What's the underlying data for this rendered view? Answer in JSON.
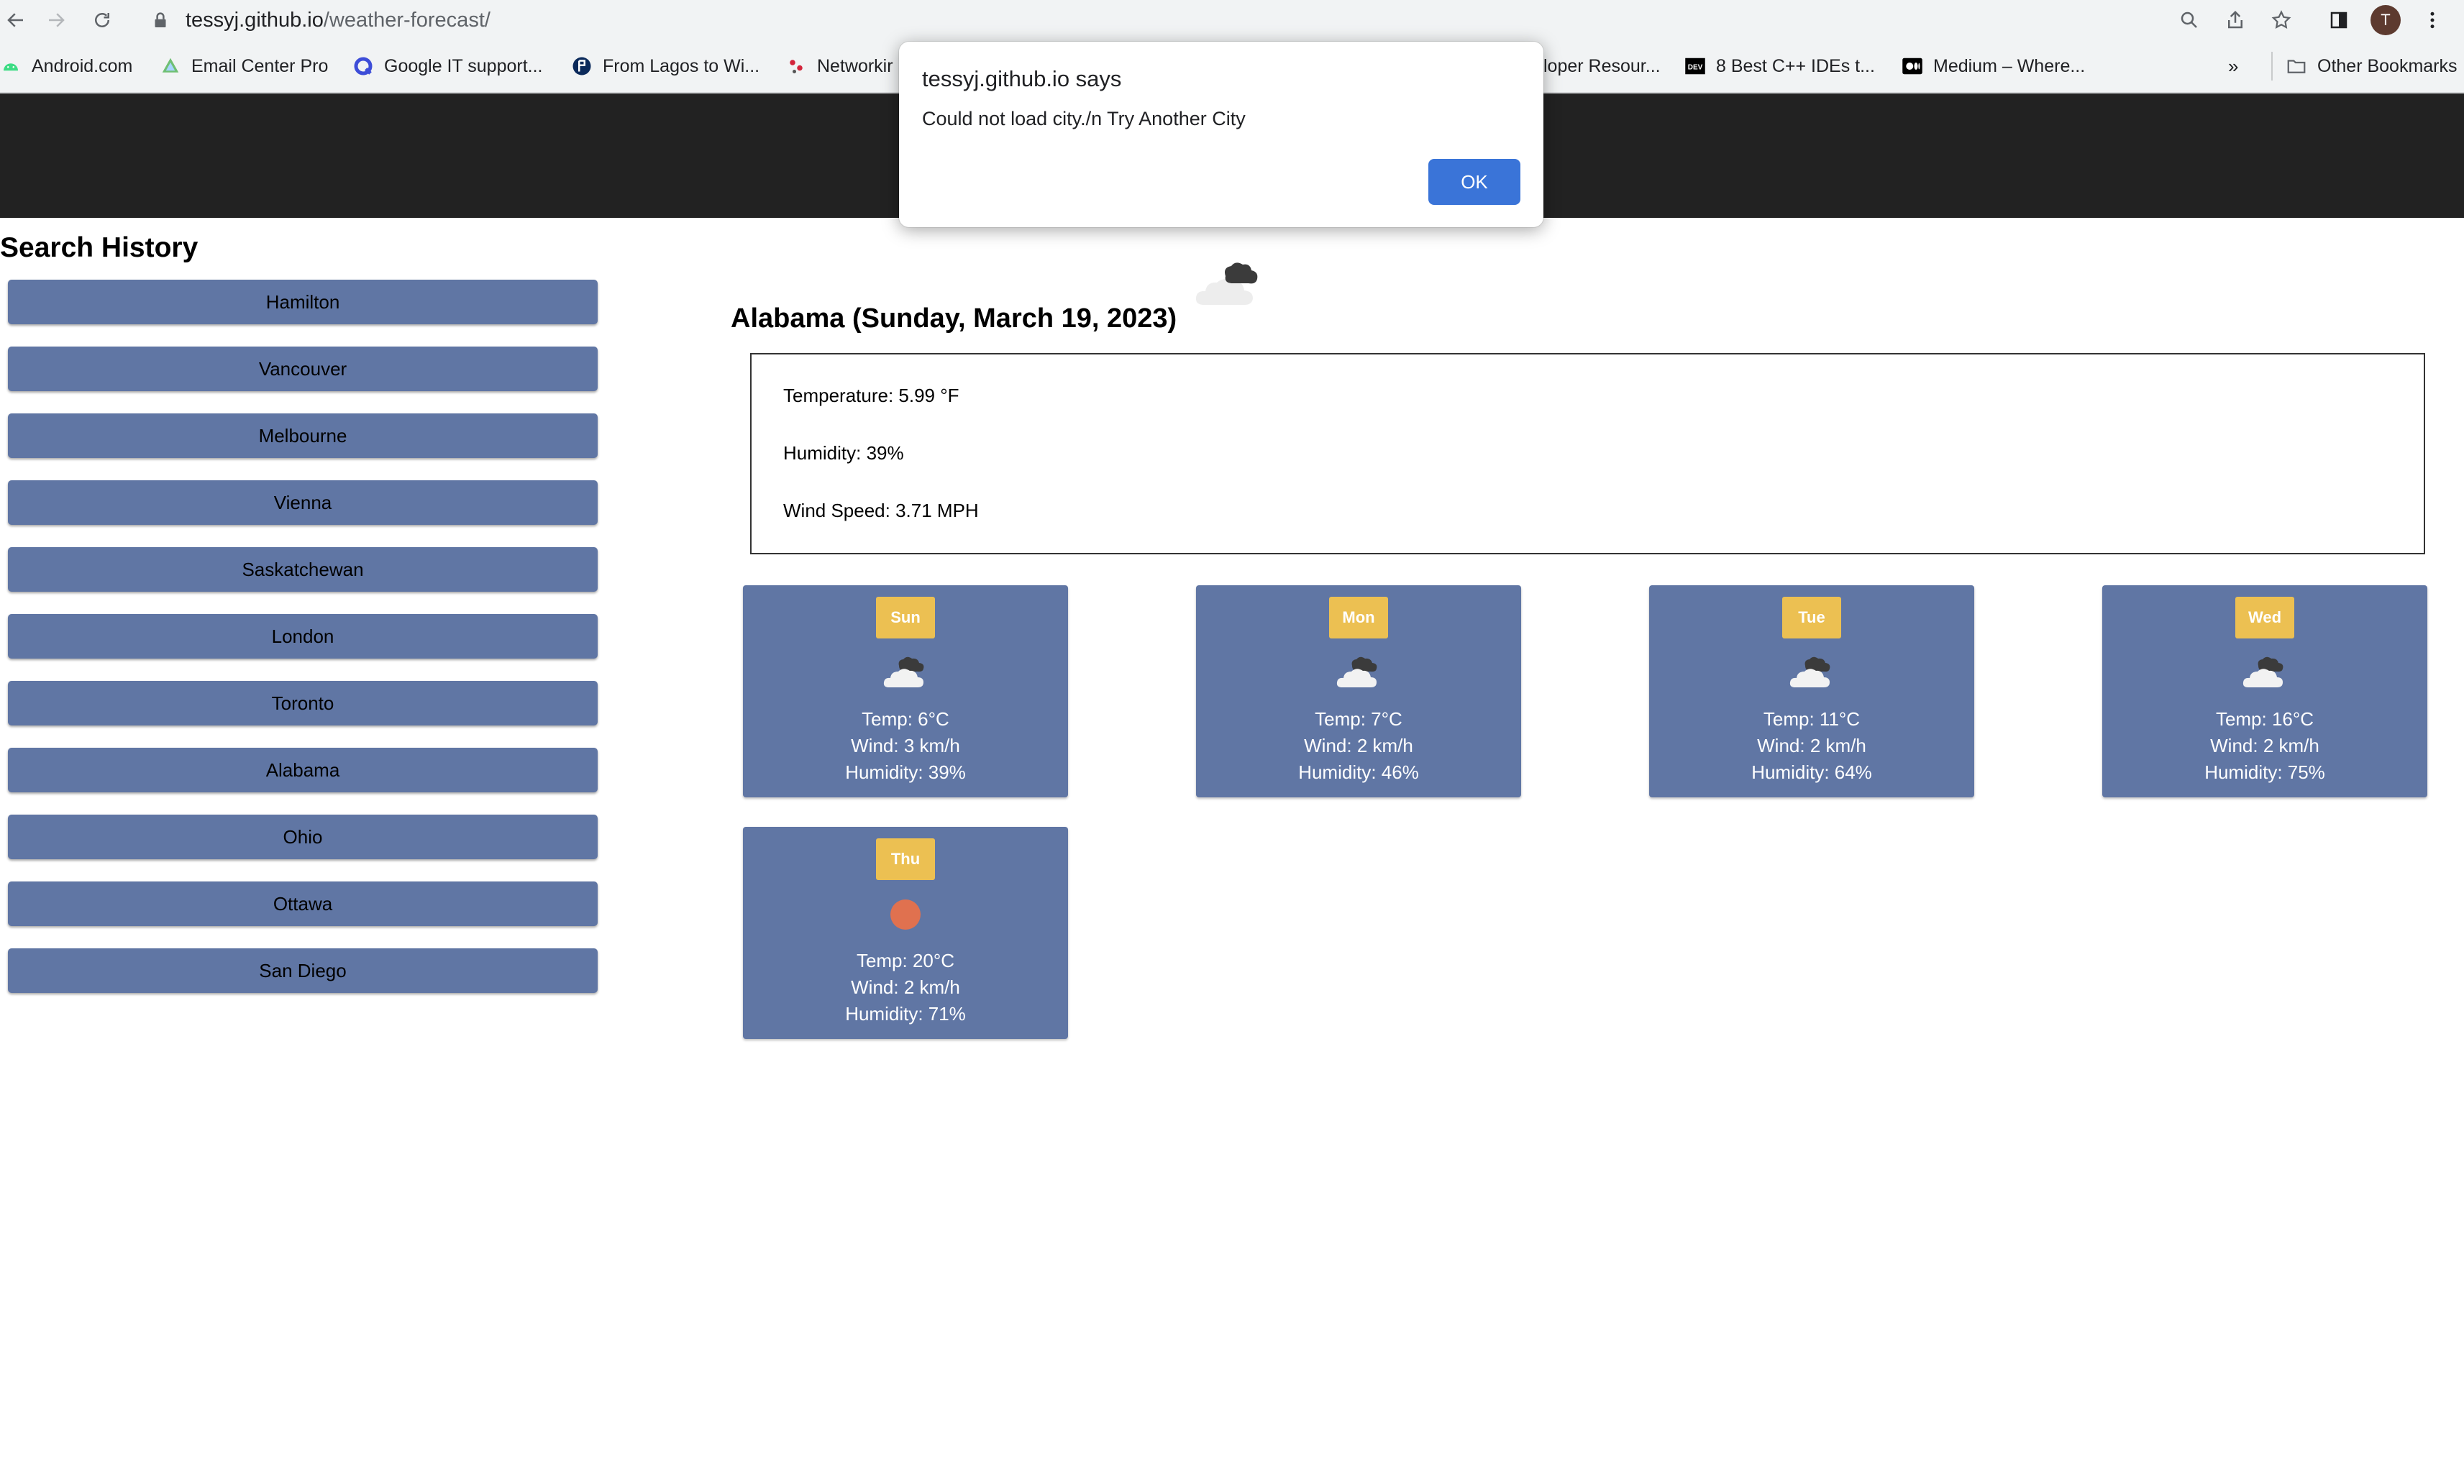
{
  "browser": {
    "url_host": "tessyj.github.io",
    "url_path": "/weather-forecast/",
    "profile_initial": "T",
    "bookmarks": [
      {
        "label": "Android.com",
        "icon": "android-icon"
      },
      {
        "label": "Email Center Pro",
        "icon": "email-center-icon"
      },
      {
        "label": "Google IT support...",
        "icon": "q-logo-icon"
      },
      {
        "label": "From Lagos to Wi...",
        "icon": "site-logo-icon"
      },
      {
        "label": "Networkir",
        "icon": "network-icon"
      },
      {
        "label": "loper Resour...",
        "icon": ""
      },
      {
        "label": "8 Best C++ IDEs t...",
        "icon": "dev-icon"
      },
      {
        "label": "Medium – Where...",
        "icon": "medium-icon"
      }
    ],
    "more_bookmarks": "»",
    "other_bookmarks": "Other Bookmarks",
    "dev_logo_text": "DEV"
  },
  "alert": {
    "title": "tessyj.github.io says",
    "message": "Could not load city./n Try Another City",
    "ok_label": "OK"
  },
  "sidebar": {
    "title": "Search History",
    "items": [
      "Hamilton",
      "Vancouver",
      "Melbourne",
      "Vienna",
      "Saskatchewan",
      "London",
      "Toronto",
      "Alabama",
      "Ohio",
      "Ottawa",
      "San Diego"
    ]
  },
  "current": {
    "heading": "Alabama (Sunday, March 19, 2023)",
    "icon": "broken-clouds-icon",
    "temperature": "Temperature: 5.99 °F",
    "humidity": "Humidity: 39%",
    "wind": "Wind Speed: 3.71 MPH"
  },
  "forecast": [
    {
      "day": "Sun",
      "icon": "broken-clouds-icon",
      "temp": "Temp: 6°C",
      "wind": "Wind: 3 km/h",
      "humidity": "Humidity: 39%"
    },
    {
      "day": "Mon",
      "icon": "broken-clouds-icon",
      "temp": "Temp: 7°C",
      "wind": "Wind: 2 km/h",
      "humidity": "Humidity: 46%"
    },
    {
      "day": "Tue",
      "icon": "broken-clouds-icon",
      "temp": "Temp: 11°C",
      "wind": "Wind: 2 km/h",
      "humidity": "Humidity: 64%"
    },
    {
      "day": "Wed",
      "icon": "broken-clouds-icon",
      "temp": "Temp: 16°C",
      "wind": "Wind: 2 km/h",
      "humidity": "Humidity: 75%"
    },
    {
      "day": "Thu",
      "icon": "clear-sky-sun-icon",
      "temp": "Temp: 20°C",
      "wind": "Wind: 2 km/h",
      "humidity": "Humidity: 71%"
    }
  ],
  "colors": {
    "header_bg": "#222222",
    "card_bg": "#6076a4",
    "day_badge": "#ecc052",
    "ok_button": "#3a74d8",
    "sun": "#e0714f"
  }
}
